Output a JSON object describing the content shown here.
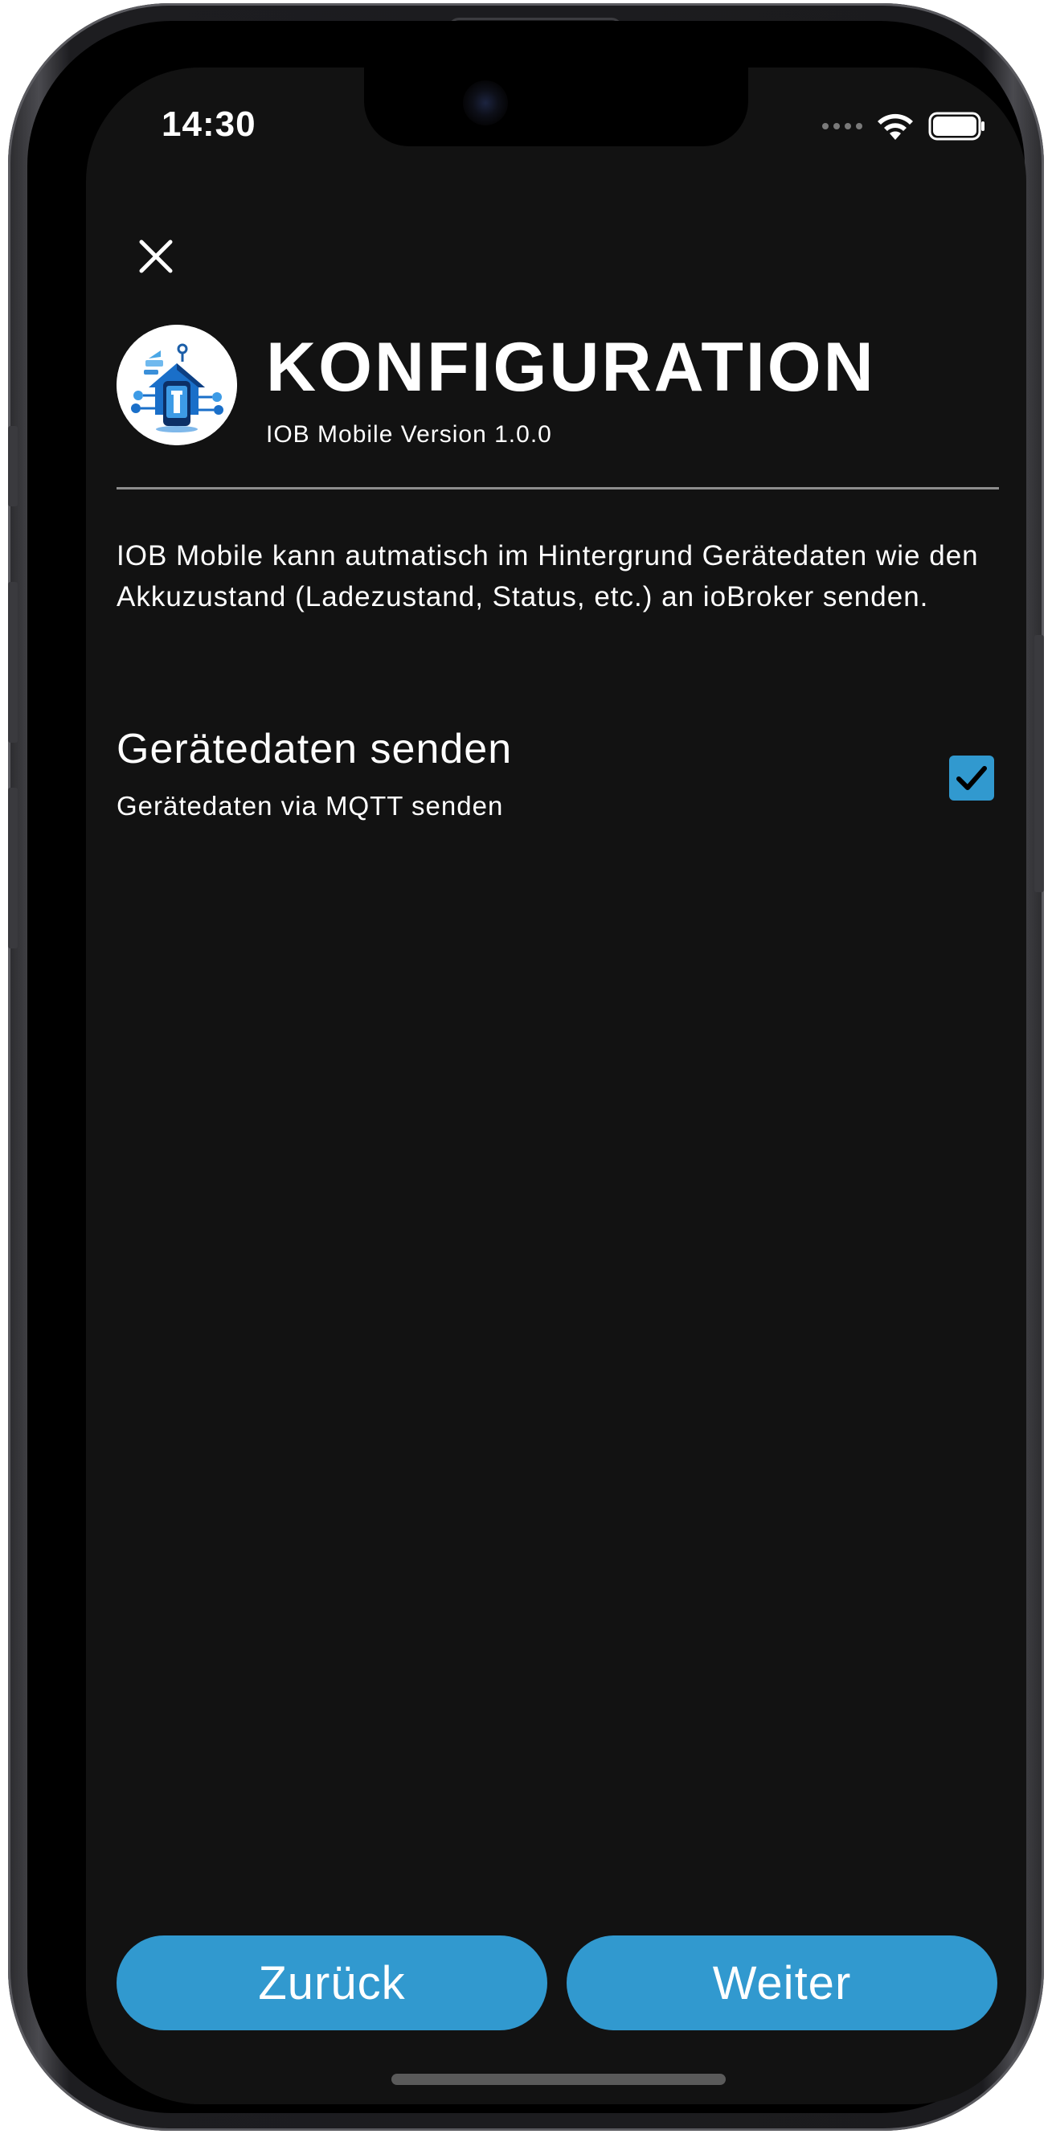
{
  "status_bar": {
    "time": "14:30"
  },
  "header": {
    "close_icon": "close-icon",
    "logo_icon": "iob-mobile-logo-icon",
    "title": "KONFIGURATION",
    "version": "IOB Mobile Version 1.0.0"
  },
  "description": "IOB Mobile kann autmatisch im Hintergrund Gerätedaten wie den Akkuzustand (Ladezustand, Status, etc.) an ioBroker senden.",
  "setting": {
    "title": "Gerätedaten senden",
    "subtitle": "Gerätedaten via MQTT senden",
    "checked": true
  },
  "buttons": {
    "back_label": "Zurück",
    "next_label": "Weiter"
  },
  "colors": {
    "accent": "#3199cf",
    "background": "#121212",
    "text": "#ffffff"
  }
}
